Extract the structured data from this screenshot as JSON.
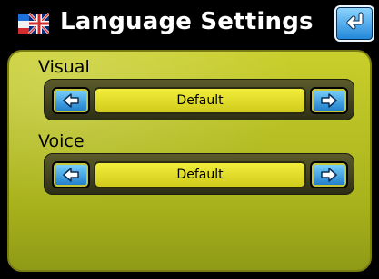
{
  "header": {
    "title": "Language Settings",
    "icons": {
      "flag": "flag-icon",
      "back": "return-arrow-icon"
    }
  },
  "sections": [
    {
      "label": "Visual",
      "value": "Default"
    },
    {
      "label": "Voice",
      "value": "Default"
    }
  ],
  "colors": {
    "accent_blue": "#1f86d8",
    "panel_green_yellow": "#b8c024",
    "value_yellow": "#f2ee3b"
  }
}
